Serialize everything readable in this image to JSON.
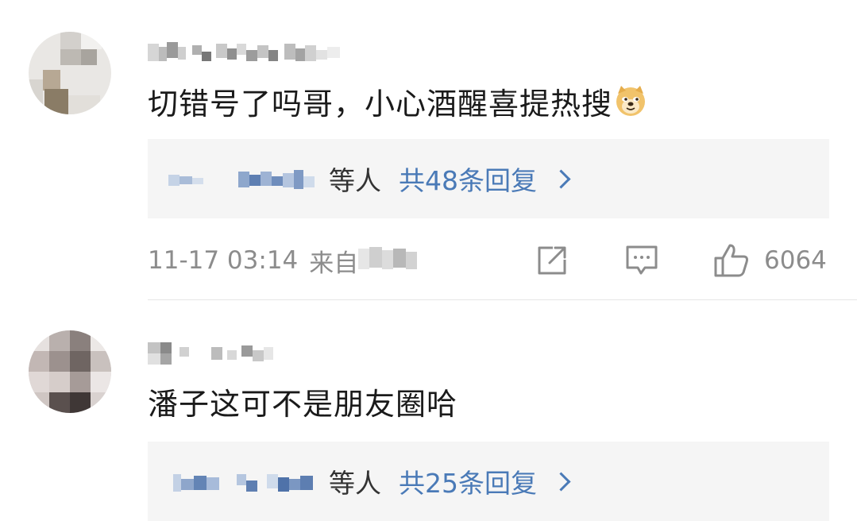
{
  "comments": [
    {
      "text": "切错号了吗哥，小心酒醒喜提热搜",
      "emoji": "doge-emoji",
      "reply_suffix": "等人",
      "reply_count_label": "共48条回复",
      "timestamp": "11-17 03:14",
      "source_prefix": "来自",
      "like_count": "6064"
    },
    {
      "text": "潘子这可不是朋友圈哈",
      "reply_suffix": "等人",
      "reply_count_label": "共25条回复"
    }
  ],
  "icons": {
    "share": "share-icon",
    "comment": "comment-icon",
    "like": "thumbs-up-icon",
    "chevron": "chevron-right-icon"
  },
  "colors": {
    "link_blue": "#4a7ab7",
    "meta_gray": "#8c8c8c",
    "reply_bg": "#f5f5f5",
    "text": "#1a1a1a"
  }
}
